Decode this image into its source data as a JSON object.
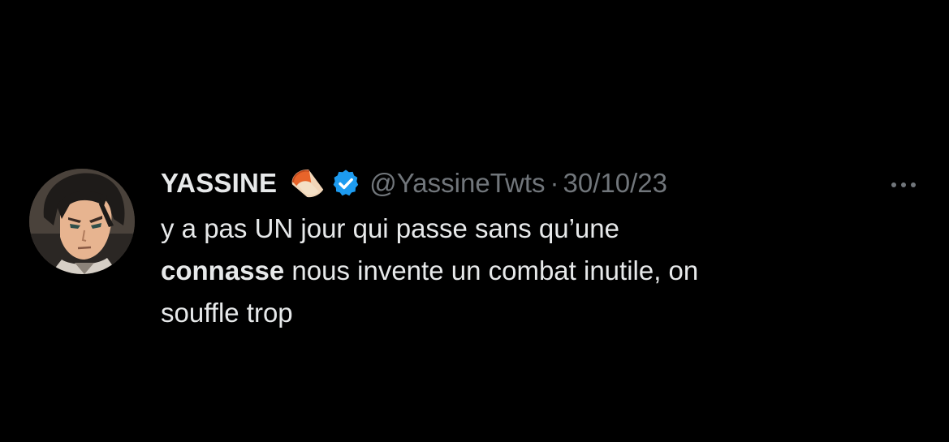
{
  "tweet": {
    "display_name": "YASSINE",
    "handle": "@YassineTwts",
    "separator": "·",
    "date": "30/10/23",
    "text": {
      "line1": "y a pas UN jour qui passe sans qu’une",
      "bold_word": "connasse",
      "line2_rest": " nous invente un combat inutile, on",
      "line3": "souffle trop"
    },
    "icons": {
      "emoji": "volleyball-emoji-icon",
      "verified": "verified-badge-icon",
      "more": "more-options-icon",
      "avatar": "anime-avatar"
    },
    "colors": {
      "background": "#000000",
      "text": "#e7e9ea",
      "muted": "#71767b",
      "verified": "#1d9bf0"
    }
  }
}
